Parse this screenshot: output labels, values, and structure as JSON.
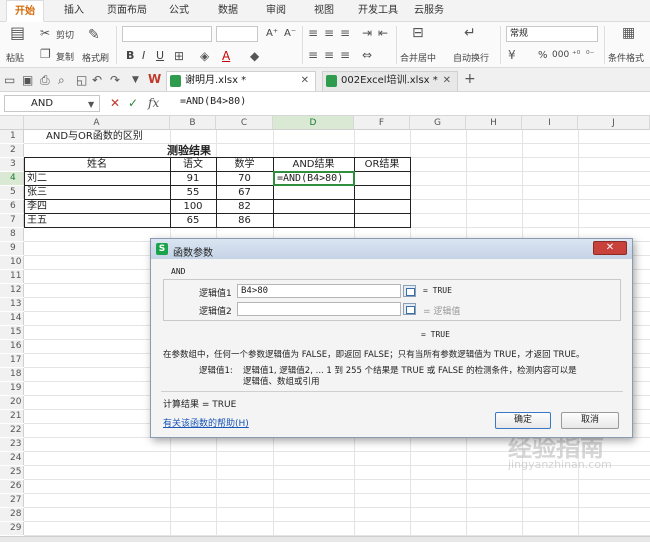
{
  "ribbon_tabs": [
    "开始",
    "插入",
    "页面布局",
    "公式",
    "数据",
    "审阅",
    "视图",
    "开发工具",
    "云服务"
  ],
  "ribbon": {
    "paste": "粘贴",
    "cut": "剪切",
    "copy": "复制",
    "format_painter": "格式刷",
    "bold": "B",
    "italic": "I",
    "underline": "U",
    "font_grow": "A⁺",
    "font_shrink": "A⁻",
    "merge_center": "合并居中",
    "wrap_text": "自动换行",
    "number_format": "常规",
    "percent": "%",
    "comma": "000",
    "conditional_format": "条件格式"
  },
  "doc_tabs": [
    {
      "label": "谢明月.xlsx *",
      "active": true
    },
    {
      "label": "002Excel培训.xlsx *",
      "active": false
    }
  ],
  "formula_bar": {
    "name_box": "AND",
    "cancel": "✕",
    "enter": "✓",
    "fx": "fx",
    "formula": "=AND(B4>80)"
  },
  "columns": [
    "A",
    "B",
    "C",
    "D",
    "F",
    "G",
    "H",
    "I",
    "J"
  ],
  "rows": [
    "1",
    "2",
    "3",
    "4",
    "5",
    "6",
    "7",
    "8",
    "9",
    "10",
    "11",
    "12",
    "13",
    "14",
    "15",
    "16",
    "17",
    "18",
    "19",
    "20",
    "21",
    "22",
    "23",
    "24",
    "25",
    "26",
    "27",
    "28",
    "29"
  ],
  "sheet": {
    "a1": "AND与OR函数的区别",
    "title": "测验结果",
    "headers": [
      "姓名",
      "语文",
      "数学",
      "AND结果",
      "OR结果"
    ],
    "records": [
      {
        "name": "刘二",
        "chinese": "91",
        "math": "70",
        "and": "=AND(B4>80)",
        "or": ""
      },
      {
        "name": "张三",
        "chinese": "55",
        "math": "67",
        "and": "",
        "or": ""
      },
      {
        "name": "李四",
        "chinese": "100",
        "math": "82",
        "and": "",
        "or": ""
      },
      {
        "name": "王五",
        "chinese": "65",
        "math": "86",
        "and": "",
        "or": ""
      }
    ]
  },
  "dialog": {
    "title": "函数参数",
    "function_name": "AND",
    "arg1_label": "逻辑值1",
    "arg1_value": "B4>80",
    "arg1_result": "= TRUE",
    "arg2_label": "逻辑值2",
    "arg2_result": "= 逻辑值",
    "overall_result": "= TRUE",
    "description": "在参数组中，任何一个参数逻辑值为 FALSE，即返回 FALSE；只有当所有参数逻辑值为 TRUE，才返回 TRUE。",
    "arg_help_label": "逻辑值1:",
    "arg_help_line1": "逻辑值1, 逻辑值2, ... 1 到 255 个结果是 TRUE 或 FALSE 的检测条件，检测内容可以是",
    "arg_help_line2": "逻辑值、数组或引用",
    "calc_result": "计算结果 = TRUE",
    "help_link": "有关该函数的帮助(H)",
    "ok": "确定",
    "cancel": "取消"
  },
  "watermark": {
    "line1": "经验指南",
    "line2": "jingyanzhinan.com"
  },
  "colors": {
    "accent_orange": "#d46b08",
    "selection_green": "#1e7a33",
    "dialog_close_red": "#c8413a"
  }
}
